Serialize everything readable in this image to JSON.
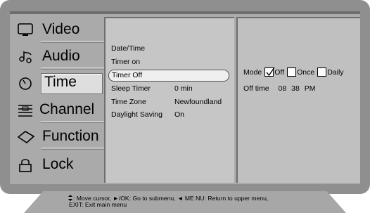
{
  "menu": {
    "items": [
      {
        "label": "Video",
        "icon": "monitor-icon"
      },
      {
        "label": "Audio",
        "icon": "audio-note-icon"
      },
      {
        "label": "Time",
        "icon": "clock-icon"
      },
      {
        "label": "Channel",
        "icon": "channel-list-icon"
      },
      {
        "label": "Function",
        "icon": "function-diamond-icon"
      },
      {
        "label": "Lock",
        "icon": "padlock-icon"
      }
    ],
    "selected": "Time"
  },
  "submenu": {
    "items": [
      {
        "label": "Date/Time",
        "value": ""
      },
      {
        "label": "Timer on",
        "value": ""
      },
      {
        "label": "Timer Off",
        "value": ""
      },
      {
        "label": "Sleep Timer",
        "value": "0 min"
      },
      {
        "label": "Time Zone",
        "value": "Newfoundland"
      },
      {
        "label": "Daylight Saving",
        "value": "On"
      }
    ],
    "selected": "Timer Off"
  },
  "detail": {
    "mode_label": "Mode",
    "options": [
      {
        "label": "Off",
        "checked": true
      },
      {
        "label": "Once",
        "checked": false
      },
      {
        "label": "Daily",
        "checked": false
      }
    ],
    "off_time_label": "Off time",
    "off_time_hour": "08",
    "off_time_minute": "38",
    "off_time_ampm": "PM"
  },
  "help": {
    "line1": ": Move cursor,  ►/OK: Go to submenu,  ◄ ME NU: Return to upper menu,",
    "line2": "EXIT: Exit main menu"
  },
  "colors": {
    "frame": "#8f8f8f",
    "panel": "#c6c6c6",
    "highlight": "#efefef"
  }
}
